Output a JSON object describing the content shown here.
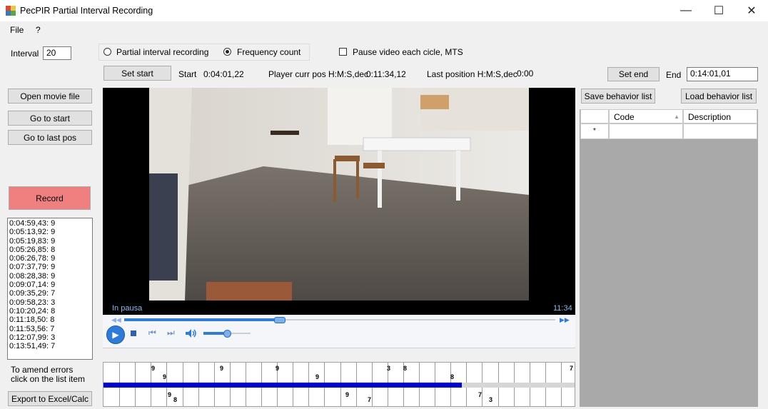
{
  "window": {
    "title": "PecPIR Partial Interval Recording",
    "min_glyph": "—",
    "max_glyph": "☐",
    "close_glyph": "✕"
  },
  "menu": {
    "file": "File",
    "help": "?"
  },
  "interval": {
    "label": "Interval",
    "value": "20"
  },
  "mode": {
    "partial_label": "Partial interval recording",
    "frequency_label": "Frequency count",
    "selected": "frequency"
  },
  "pause_video": {
    "label": "Pause video each cicle, MTS",
    "checked": false
  },
  "set_start": {
    "button": "Set start",
    "label": "Start",
    "value": "0:04:01,22"
  },
  "player_pos": {
    "label": "Player curr pos H:M:S,dec",
    "value": "0:11:34,12"
  },
  "last_pos": {
    "label": "Last position H:M:S,dec",
    "value": "0:00"
  },
  "set_end": {
    "button": "Set end",
    "label": "End",
    "value": "0:14:01,01"
  },
  "left_buttons": {
    "open": "Open movie file",
    "go_start": "Go to start",
    "go_last": "Go to last pos"
  },
  "record": {
    "label": "Record",
    "color": "#f08080"
  },
  "entries": [
    "0:04:59,43: 9",
    "0:05:13,92: 9",
    "0:05:19,83: 9",
    "0:05:26,85: 8",
    "0:06:26,78: 9",
    "0:07:37,79: 9",
    "0:08:28,38: 9",
    "0:09:07,14: 9",
    "0:09:35,29: 7",
    "0:09:58,23: 3",
    "0:10:20,24: 8",
    "0:11:18,50: 8",
    "0:11:53,56: 7",
    "0:12:07,99: 3",
    "0:13:51,49: 7"
  ],
  "amend_note": {
    "line1": "To amend errors",
    "line2": "click on the list item"
  },
  "export": "Export to Excel/Calc",
  "player": {
    "status": "In pausa",
    "time": "11:34",
    "seek_fraction": 0.36,
    "volume_fraction": 0.5,
    "accent": "#2f7bd8"
  },
  "behavior": {
    "save": "Save behavior list",
    "load": "Load behavior list",
    "col_code": "Code",
    "col_desc": "Description",
    "new_row_marker": "*"
  },
  "timeline": {
    "progress_fraction": 0.76,
    "progress_color": "#0000cc",
    "top_marks": [
      "9",
      "9",
      "9",
      "9",
      "9",
      "3",
      "8",
      "8",
      "7"
    ],
    "bottom_marks": [
      "9",
      "8",
      "9",
      "7",
      "7",
      "3"
    ]
  }
}
